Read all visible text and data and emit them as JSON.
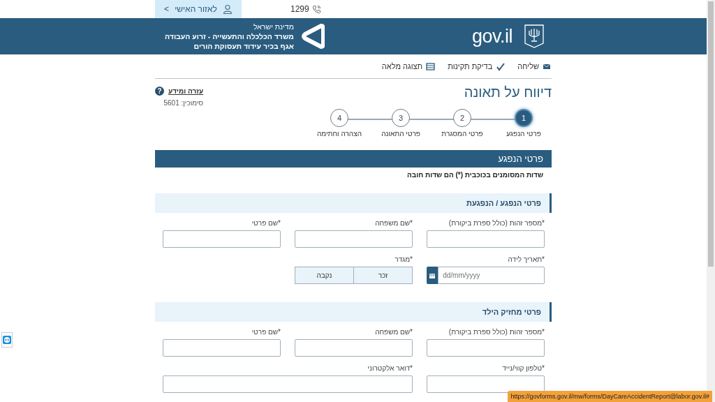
{
  "top_bar": {
    "personal_area": {
      "label": "לאזור האישי",
      "chevron": ">"
    },
    "phone": "1299"
  },
  "header": {
    "org_lines": [
      "מדינת ישראל",
      "משרד הכלכלה והתעשייה - זרוע העבודה",
      "אגף בכיר עידוד תעסוקת הורים"
    ],
    "logo": "gov.il"
  },
  "toolbar": [
    {
      "kind": "send",
      "label": "שליחה"
    },
    {
      "kind": "check",
      "label": "בדיקת תקינות"
    },
    {
      "kind": "view",
      "label": "תצוגה מלאה"
    }
  ],
  "title": "דיווח על תאונה",
  "help_link": "עזרה ומידע",
  "help_icon": "?",
  "reference": "סימוכין: 5601",
  "steps": [
    {
      "number": "1",
      "label": "פרטי הנפגע",
      "selected": true
    },
    {
      "number": "2",
      "label": "פרטי המסגרת",
      "selected": false
    },
    {
      "number": "3",
      "label": "פרטי התאונה",
      "selected": false
    },
    {
      "number": "4",
      "label": "הצהרה וחתימה",
      "selected": false
    }
  ],
  "section": {
    "title": "פרטי הנפגע",
    "note": "שדות המסומנים בכוכבית (*) הם שדות חובה",
    "subsections": [
      {
        "title": "פרטי הנפגע / הנפגעת",
        "fields": [
          {
            "kind": "text",
            "label": "*מספר זהות (כולל ספרת ביקורת)"
          },
          {
            "kind": "text",
            "label": "*שם משפחה"
          },
          {
            "kind": "text",
            "label": "*שם פרטי"
          },
          {
            "kind": "date",
            "label": "*תאריך לידה",
            "placeholder": "dd/mm/yyyy"
          },
          {
            "kind": "toggle",
            "label": "*מגדר",
            "options": [
              {
                "label": "זכר",
                "selected": false
              },
              {
                "label": "נקבה",
                "selected": false
              }
            ]
          }
        ]
      },
      {
        "title": "פרטי מחזיק הילד",
        "fields": [
          {
            "kind": "text",
            "label": "*מספר זהות (כולל ספרת ביקורת)"
          },
          {
            "kind": "text",
            "label": "*שם משפחה"
          },
          {
            "kind": "text",
            "label": "*שם פרטי"
          },
          {
            "kind": "text",
            "label": "*טלפון קווי/נייד"
          },
          {
            "kind": "email",
            "label": "*דואר אלקטרוני"
          }
        ]
      }
    ]
  },
  "status_bar": "https://govforms.gov.il/mw/forms/DayCareAccidentReport@labor.gov.il#"
}
